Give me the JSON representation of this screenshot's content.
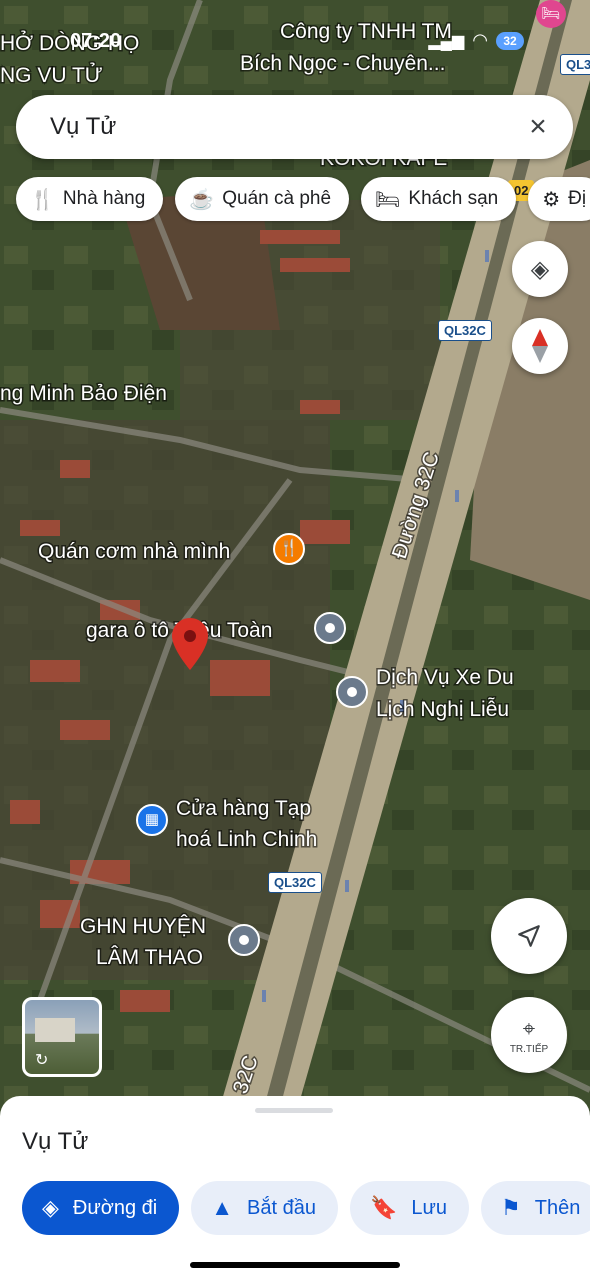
{
  "status_bar": {
    "time": "07:20",
    "battery": "32"
  },
  "search": {
    "query": "Vụ Tử"
  },
  "chips": [
    {
      "icon": "restaurant-icon",
      "label": "Nhà hàng"
    },
    {
      "icon": "coffee-icon",
      "label": "Quán cà phê"
    },
    {
      "icon": "hotel-icon",
      "label": "Khách sạn"
    },
    {
      "icon": "attraction-icon",
      "label": "Đị"
    }
  ],
  "map_labels": {
    "top_left_1": "HỞ DÒNG HỌ",
    "top_left_2": "NG VU TỬ",
    "company_1": "Công ty TNHH TM",
    "company_2": "Bích Ngọc - Chuyên...",
    "kokoi": "KOKOI KAFE",
    "ql_top": "QL3",
    "o2": "02",
    "minh_bao_dien": "ng Minh Bảo Điện",
    "road_32c": "Đường 32C",
    "quan_com": "Quán cơm nhà mình",
    "gara": "gara ô tô Triệu Toàn",
    "dich_vu_1": "Dịch Vụ Xe Du",
    "dich_vu_2": "Lịch Nghị Liễu",
    "tap_hoa_1": "Cửa hàng Tạp",
    "tap_hoa_2": "hoá Linh Chinh",
    "ghn_1": "GHN HUYỆN",
    "ghn_2": "LÂM THAO",
    "road_bottom": "32C"
  },
  "road_shields": {
    "shield_1": "QL32C",
    "shield_2": "QL32C"
  },
  "buttons": {
    "next_label": "TR.TIẾP"
  },
  "sheet": {
    "title": "Vụ Tử",
    "actions": [
      {
        "icon": "directions-icon",
        "label": "Đường đi"
      },
      {
        "icon": "navigation-arrow-icon",
        "label": "Bắt đầu"
      },
      {
        "icon": "bookmark-icon",
        "label": "Lưu"
      },
      {
        "icon": "flag-icon",
        "label": "Thên"
      }
    ]
  },
  "colors": {
    "accent": "#0b57d0",
    "pin": "#d93025",
    "food_pin": "#f57c00",
    "shop_pin": "#1a73e8"
  }
}
